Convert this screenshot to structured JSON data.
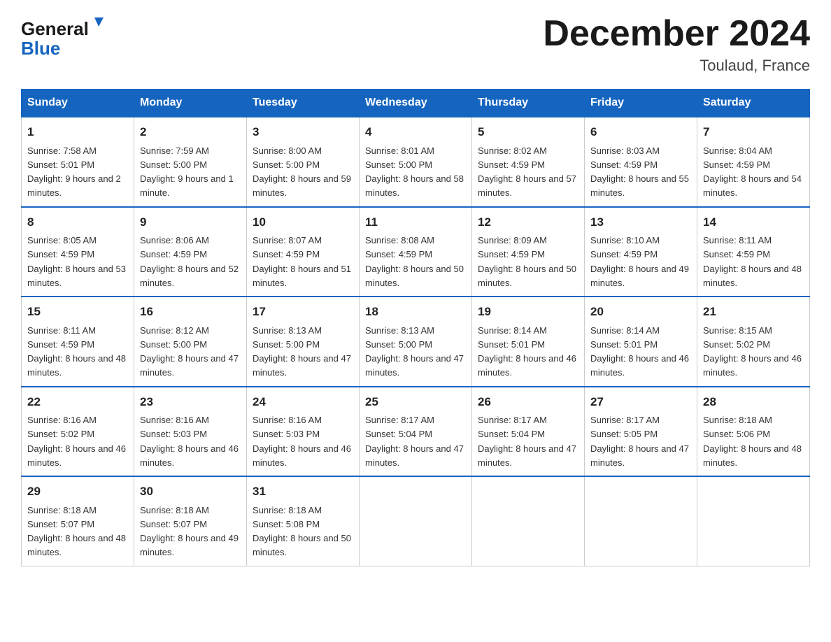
{
  "header": {
    "logo": {
      "general": "General",
      "blue": "Blue",
      "alt": "GeneralBlue logo"
    },
    "title": "December 2024",
    "location": "Toulaud, France"
  },
  "weekdays": [
    "Sunday",
    "Monday",
    "Tuesday",
    "Wednesday",
    "Thursday",
    "Friday",
    "Saturday"
  ],
  "weeks": [
    [
      {
        "day": "1",
        "sunrise": "7:58 AM",
        "sunset": "5:01 PM",
        "daylight": "9 hours and 2 minutes."
      },
      {
        "day": "2",
        "sunrise": "7:59 AM",
        "sunset": "5:00 PM",
        "daylight": "9 hours and 1 minute."
      },
      {
        "day": "3",
        "sunrise": "8:00 AM",
        "sunset": "5:00 PM",
        "daylight": "8 hours and 59 minutes."
      },
      {
        "day": "4",
        "sunrise": "8:01 AM",
        "sunset": "5:00 PM",
        "daylight": "8 hours and 58 minutes."
      },
      {
        "day": "5",
        "sunrise": "8:02 AM",
        "sunset": "4:59 PM",
        "daylight": "8 hours and 57 minutes."
      },
      {
        "day": "6",
        "sunrise": "8:03 AM",
        "sunset": "4:59 PM",
        "daylight": "8 hours and 55 minutes."
      },
      {
        "day": "7",
        "sunrise": "8:04 AM",
        "sunset": "4:59 PM",
        "daylight": "8 hours and 54 minutes."
      }
    ],
    [
      {
        "day": "8",
        "sunrise": "8:05 AM",
        "sunset": "4:59 PM",
        "daylight": "8 hours and 53 minutes."
      },
      {
        "day": "9",
        "sunrise": "8:06 AM",
        "sunset": "4:59 PM",
        "daylight": "8 hours and 52 minutes."
      },
      {
        "day": "10",
        "sunrise": "8:07 AM",
        "sunset": "4:59 PM",
        "daylight": "8 hours and 51 minutes."
      },
      {
        "day": "11",
        "sunrise": "8:08 AM",
        "sunset": "4:59 PM",
        "daylight": "8 hours and 50 minutes."
      },
      {
        "day": "12",
        "sunrise": "8:09 AM",
        "sunset": "4:59 PM",
        "daylight": "8 hours and 50 minutes."
      },
      {
        "day": "13",
        "sunrise": "8:10 AM",
        "sunset": "4:59 PM",
        "daylight": "8 hours and 49 minutes."
      },
      {
        "day": "14",
        "sunrise": "8:11 AM",
        "sunset": "4:59 PM",
        "daylight": "8 hours and 48 minutes."
      }
    ],
    [
      {
        "day": "15",
        "sunrise": "8:11 AM",
        "sunset": "4:59 PM",
        "daylight": "8 hours and 48 minutes."
      },
      {
        "day": "16",
        "sunrise": "8:12 AM",
        "sunset": "5:00 PM",
        "daylight": "8 hours and 47 minutes."
      },
      {
        "day": "17",
        "sunrise": "8:13 AM",
        "sunset": "5:00 PM",
        "daylight": "8 hours and 47 minutes."
      },
      {
        "day": "18",
        "sunrise": "8:13 AM",
        "sunset": "5:00 PM",
        "daylight": "8 hours and 47 minutes."
      },
      {
        "day": "19",
        "sunrise": "8:14 AM",
        "sunset": "5:01 PM",
        "daylight": "8 hours and 46 minutes."
      },
      {
        "day": "20",
        "sunrise": "8:14 AM",
        "sunset": "5:01 PM",
        "daylight": "8 hours and 46 minutes."
      },
      {
        "day": "21",
        "sunrise": "8:15 AM",
        "sunset": "5:02 PM",
        "daylight": "8 hours and 46 minutes."
      }
    ],
    [
      {
        "day": "22",
        "sunrise": "8:16 AM",
        "sunset": "5:02 PM",
        "daylight": "8 hours and 46 minutes."
      },
      {
        "day": "23",
        "sunrise": "8:16 AM",
        "sunset": "5:03 PM",
        "daylight": "8 hours and 46 minutes."
      },
      {
        "day": "24",
        "sunrise": "8:16 AM",
        "sunset": "5:03 PM",
        "daylight": "8 hours and 46 minutes."
      },
      {
        "day": "25",
        "sunrise": "8:17 AM",
        "sunset": "5:04 PM",
        "daylight": "8 hours and 47 minutes."
      },
      {
        "day": "26",
        "sunrise": "8:17 AM",
        "sunset": "5:04 PM",
        "daylight": "8 hours and 47 minutes."
      },
      {
        "day": "27",
        "sunrise": "8:17 AM",
        "sunset": "5:05 PM",
        "daylight": "8 hours and 47 minutes."
      },
      {
        "day": "28",
        "sunrise": "8:18 AM",
        "sunset": "5:06 PM",
        "daylight": "8 hours and 48 minutes."
      }
    ],
    [
      {
        "day": "29",
        "sunrise": "8:18 AM",
        "sunset": "5:07 PM",
        "daylight": "8 hours and 48 minutes."
      },
      {
        "day": "30",
        "sunrise": "8:18 AM",
        "sunset": "5:07 PM",
        "daylight": "8 hours and 49 minutes."
      },
      {
        "day": "31",
        "sunrise": "8:18 AM",
        "sunset": "5:08 PM",
        "daylight": "8 hours and 50 minutes."
      },
      null,
      null,
      null,
      null
    ]
  ]
}
